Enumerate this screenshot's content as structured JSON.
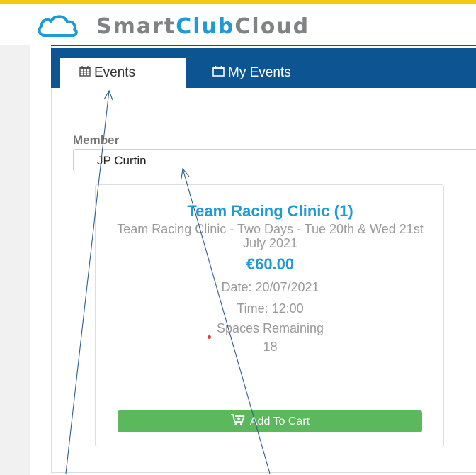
{
  "brand": {
    "name_part1": "Smart",
    "name_part2": "Club",
    "name_part3": "Cloud",
    "colors": {
      "accent": "#1f9ad6",
      "gray": "#808284",
      "topbar": "#f2c811",
      "nav": "#0d5592",
      "button": "#5cb85c"
    }
  },
  "tabs": [
    {
      "label": "Events",
      "icon": "calendar-icon",
      "active": true
    },
    {
      "label": "My Events",
      "icon": "calendar-outline-icon",
      "active": false
    }
  ],
  "member": {
    "label": "Member",
    "value": "JP Curtin"
  },
  "event": {
    "title": "Team Racing Clinic (1)",
    "description": "Team Racing Clinic - Two Days - Tue 20th & Wed 21st July 2021",
    "price": "€60.00",
    "date": "Date: 20/07/2021",
    "time": "Time: 12:00",
    "spaces_label": "Spaces Remaining",
    "spaces_value": "18",
    "add_to_cart": "Add To Cart",
    "cart_icon": "cart-plus-icon"
  }
}
